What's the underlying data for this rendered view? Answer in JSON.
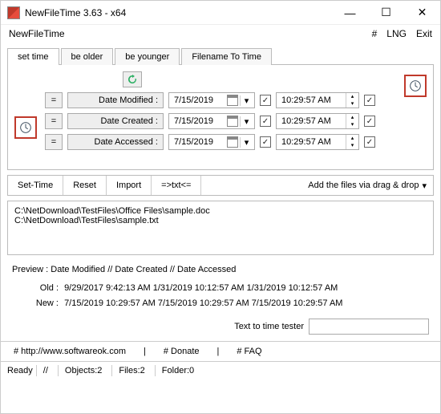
{
  "window": {
    "title": "NewFileTime 3.63 - x64"
  },
  "menubar": {
    "leftLabel": "NewFileTime",
    "hash": "#",
    "lng": "LNG",
    "exit": "Exit"
  },
  "tabs": {
    "setTime": "set time",
    "beOlder": "be older",
    "beYounger": "be younger",
    "filenameToTime": "Filename To Time"
  },
  "fields": {
    "modified": {
      "eq": "=",
      "label": "Date Modified :",
      "date": "7/15/2019",
      "time": "10:29:57 AM"
    },
    "created": {
      "eq": "=",
      "label": "Date Created :",
      "date": "7/15/2019",
      "time": "10:29:57 AM"
    },
    "accessed": {
      "eq": "=",
      "label": "Date Accessed :",
      "date": "7/15/2019",
      "time": "10:29:57 AM"
    }
  },
  "toolbar": {
    "setTime": "Set-Time",
    "reset": "Reset",
    "import": "Import",
    "txt": "=>txt<=",
    "dragDrop": "Add the files via drag & drop"
  },
  "files": {
    "f0": "C:\\NetDownload\\TestFiles\\Office Files\\sample.doc",
    "f1": "C:\\NetDownload\\TestFiles\\sample.txt"
  },
  "preview": {
    "header": "Preview  :   Date Modified    //   Date Created    //   Date Accessed",
    "oldLabel": "Old :",
    "newLabel": "New :",
    "oldLine": "9/29/2017 9:42:13 AM   1/31/2019 10:12:57 AM  1/31/2019 10:12:57 AM",
    "newLine": "7/15/2019 10:29:57 AM  7/15/2019 10:29:57 AM  7/15/2019 10:29:57 AM",
    "tester": "Text to time tester"
  },
  "links": {
    "site": "# http://www.softwareok.com",
    "donate": "# Donate",
    "faq": "# FAQ"
  },
  "status": {
    "ready": "Ready",
    "objects": "Objects:2",
    "files": "Files:2",
    "folder": "Folder:0",
    "sep": "//"
  }
}
